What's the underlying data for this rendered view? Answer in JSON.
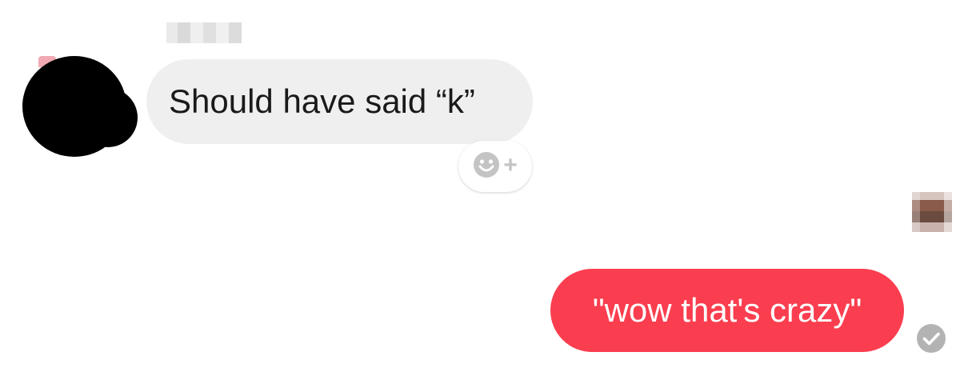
{
  "colors": {
    "incoming_bubble": "#efefef",
    "outgoing_bubble": "#fa3e4f",
    "reaction_icon": "#c4c4c4",
    "status_icon": "#b3b3b3"
  },
  "conversation": {
    "incoming": {
      "text": "Should have said “k”",
      "sender_avatar_icon": "avatar-redacted",
      "reaction_button_icons": [
        "smiley-icon",
        "plus-icon"
      ]
    },
    "outgoing": {
      "text": "\"wow that's crazy\"",
      "status_icon": "delivered-check-icon"
    }
  }
}
